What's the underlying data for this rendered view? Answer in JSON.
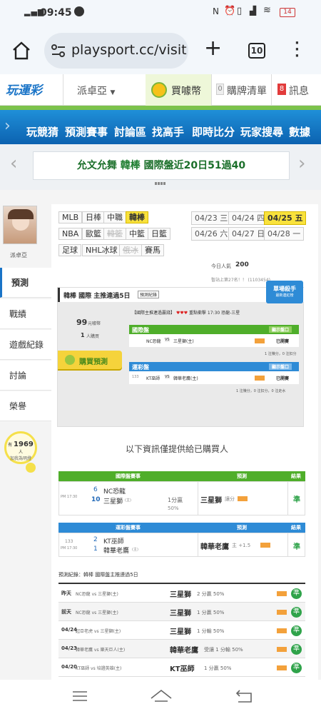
{
  "status": {
    "time": "09:45",
    "battery": "14"
  },
  "browser": {
    "url": "playsport.cc/visit",
    "tabs": "10"
  },
  "site": {
    "logo": "玩運彩",
    "user": "派卓亞",
    "buy_coins": "買噱幣",
    "cart_count": "0",
    "cart_label": "購牌清單",
    "msg_count": "8",
    "msg_label": "訊息"
  },
  "nav": [
    "玩競猜",
    "預測賽事",
    "討論區",
    "找高手",
    "即時比分",
    "玩家搜尋",
    "數據"
  ],
  "banner": {
    "text_a": "允文允舞",
    "text_b": "韓棒",
    "text_c": "國際盤近20日51過40"
  },
  "profile": {
    "name": "派卓亞"
  },
  "tabs": [
    "預測",
    "戰績",
    "遊戲紀錄",
    "討論",
    "榮譽"
  ],
  "fans": {
    "prefix": "有",
    "count": "1969",
    "suffix": "人",
    "sub": "加我為明燈"
  },
  "leagues_row1": [
    "MLB",
    "日棒",
    "中職",
    "韓棒"
  ],
  "leagues_row2": [
    "NBA",
    "歐籃",
    "韓籃",
    "中籃",
    "日籃"
  ],
  "leagues_row3": [
    "足球",
    "NHL冰球",
    "俄冰",
    "賽馬"
  ],
  "dates_row1": [
    "04/23 三",
    "04/24 四",
    "04/25 五"
  ],
  "dates_row2": [
    "04/26 六",
    "04/27 日",
    "04/28 一"
  ],
  "visitors": {
    "label": "今日人氣",
    "count": "200"
  },
  "rank_text": "暫站上第27名！！ (1103454)",
  "pick": {
    "title": "韓棒 國際 主推連過5日",
    "record_btn": "預測紀錄",
    "badge_top": "單場殺手",
    "badge_sub": "最新連紅榜",
    "price": "99",
    "price_unit": "元噱幣",
    "buyers": "1",
    "buyers_unit": "人購買",
    "buy_btn": "購買預測",
    "headline": "【國際主推連過贏錢】",
    "headline_tail": "重點衝擊 17:30 恐龍-三星"
  },
  "mini_inter": {
    "hdr": "國際盤",
    "btn": "顯示盤口",
    "match": "NC恐龍",
    "vs": "VS",
    "opp": "三星獅(主)",
    "status": "已開賽",
    "note": "1 注賺分，0 注扣分"
  },
  "mini_run": {
    "hdr": "運彩盤",
    "btn": "顯示盤口",
    "id": "133",
    "match": "KT巫師",
    "vs": "VS",
    "opp": "韓華老鷹(主)",
    "status": "已開賽",
    "note": "1 注賺分，0 注扣分，0 注走水"
  },
  "info_title": "以下資訊僅提供給已購買人",
  "t1": {
    "hdr": [
      "國際盤賽事",
      "預測",
      "結果"
    ],
    "time": "PM 17:30",
    "score_a": "6",
    "team_a": "NC恐龍",
    "score_b": "10",
    "team_b": "三星獅",
    "home": "(主)",
    "line": "1分贏",
    "pct": "50%",
    "pick": "三星獅",
    "pick_note": "讓分",
    "result": "準"
  },
  "t2": {
    "hdr": [
      "運彩盤賽事",
      "預測",
      "結果"
    ],
    "id": "133",
    "time": "PM 17:30",
    "score_a": "2",
    "team_a": "KT巫師",
    "score_b": "1",
    "team_b": "韓華老鷹",
    "home": "(主)",
    "pick": "韓華老鷹",
    "pick_note": "主 +1.5",
    "result": "準"
  },
  "records": {
    "title": "預測紀錄：韓棒 國際盤主推連過5日",
    "rows": [
      {
        "date": "昨天",
        "match": "NC恐龍 vs 三星獅(主)",
        "pick": "三星獅",
        "line": "2 分贏 50%"
      },
      {
        "date": "前天",
        "match": "NC恐龍 vs 三星獅(主)",
        "pick": "三星獅",
        "line": "1 分贏 50%"
      },
      {
        "date": "04/24",
        "match": "起亞老虎 vs 三星獅(主)",
        "pick": "三星獅",
        "line": "1 分輸 50%"
      },
      {
        "date": "04/23",
        "match": "韓華老鷹 vs 樂天巨人(主)",
        "pick": "韓華老鷹",
        "line": "受讓 1 分輸 50%"
      },
      {
        "date": "04/20",
        "match": "KT巫師 vs 培證英雄(主)",
        "pick": "KT巫師",
        "line": "1 分贏 50%"
      }
    ]
  }
}
